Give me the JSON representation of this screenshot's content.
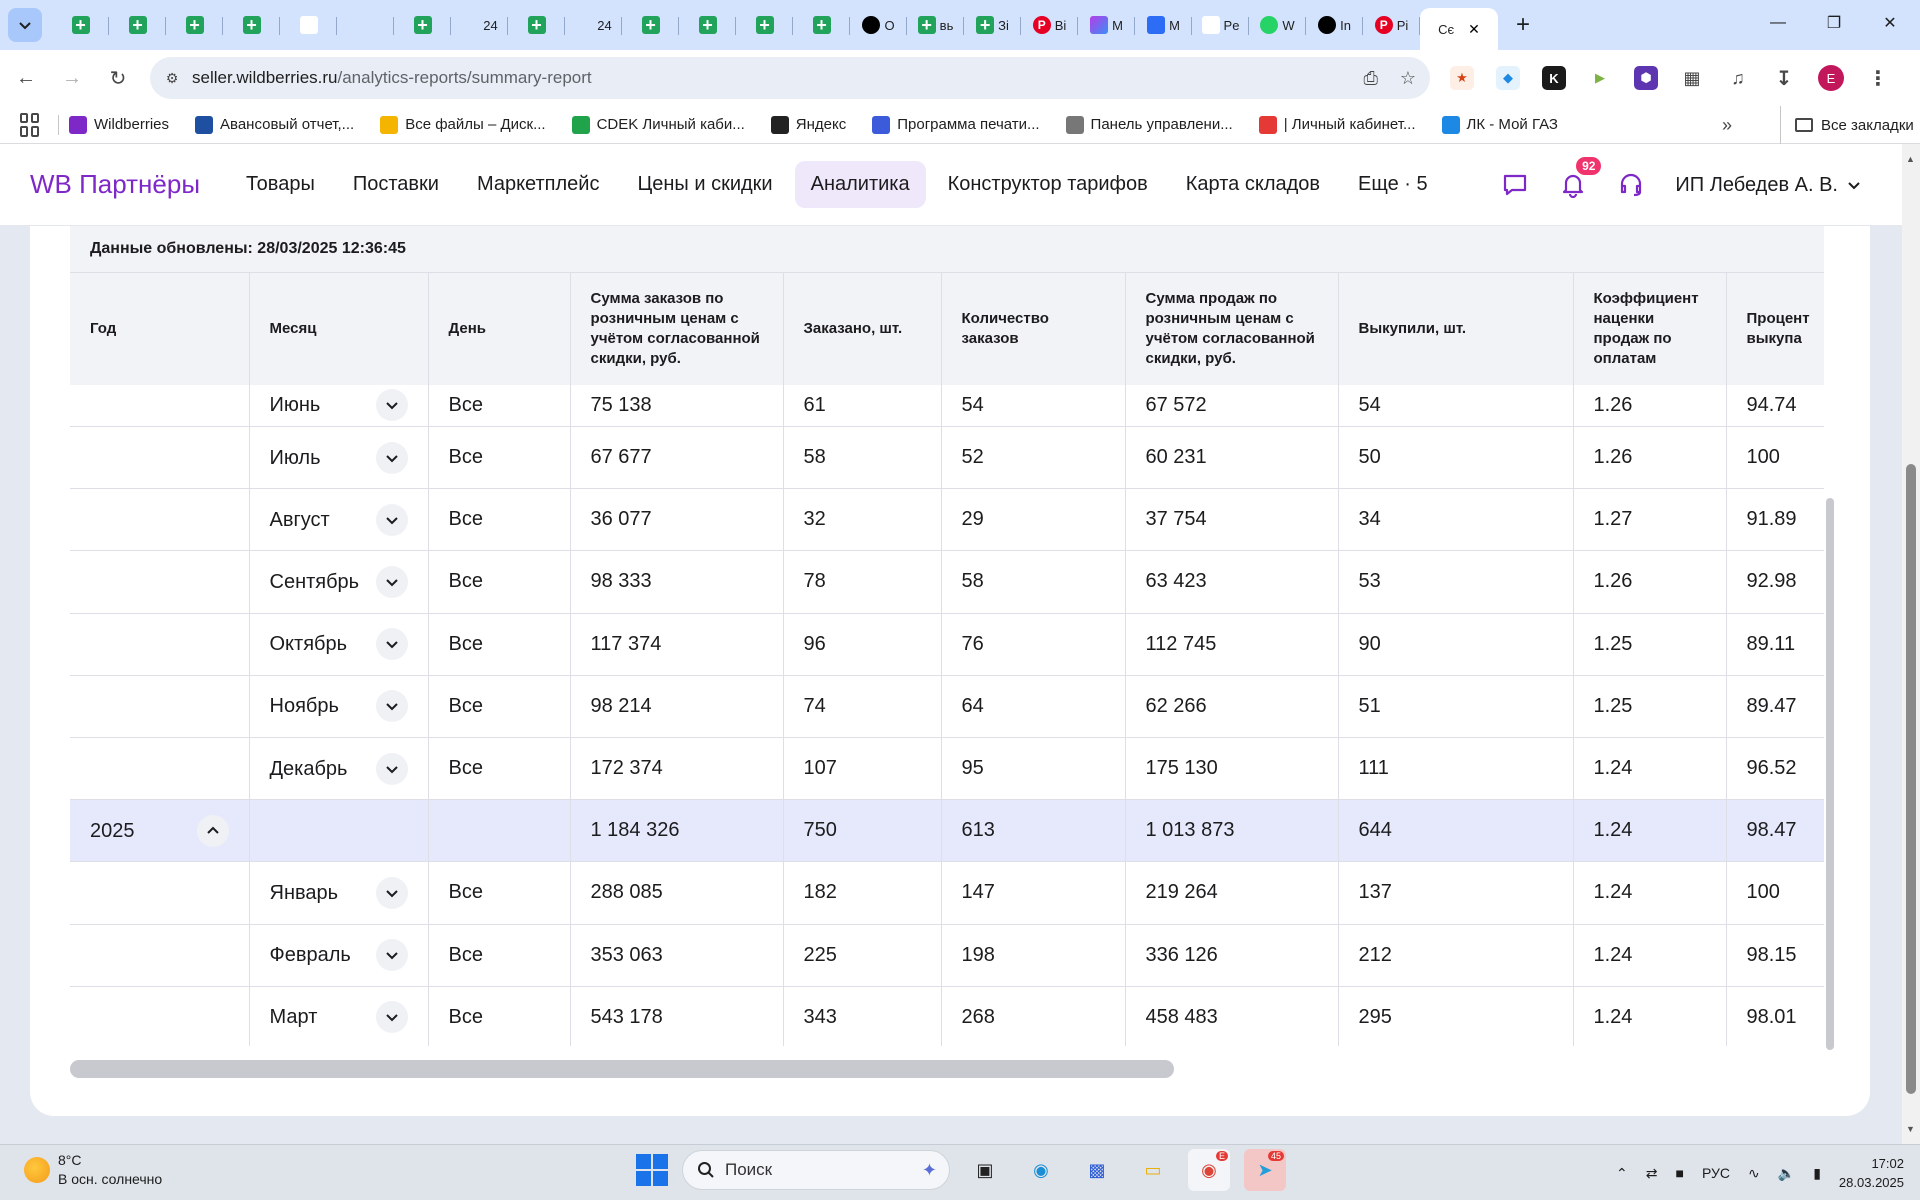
{
  "browser": {
    "tabs": [
      {
        "icon": "green",
        "label": ""
      },
      {
        "icon": "green",
        "label": ""
      },
      {
        "icon": "green",
        "label": ""
      },
      {
        "icon": "green",
        "label": ""
      },
      {
        "icon": "ya",
        "label": ""
      },
      {
        "icon": "blue",
        "label": ""
      },
      {
        "icon": "green",
        "label": ""
      },
      {
        "icon": "blue",
        "label": "24"
      },
      {
        "icon": "green",
        "label": ""
      },
      {
        "icon": "blue",
        "label": "24"
      },
      {
        "icon": "green",
        "label": ""
      },
      {
        "icon": "green",
        "label": ""
      },
      {
        "icon": "green",
        "label": ""
      },
      {
        "icon": "green",
        "label": ""
      },
      {
        "icon": "dark",
        "label": "O"
      },
      {
        "icon": "green",
        "label": "вь"
      },
      {
        "icon": "green",
        "label": "Зі"
      },
      {
        "icon": "pin",
        "label": "Ві"
      },
      {
        "icon": "purple",
        "label": "M"
      },
      {
        "icon": "msg",
        "label": "M"
      },
      {
        "icon": "ya",
        "label": "Pe"
      },
      {
        "icon": "wa",
        "label": "W"
      },
      {
        "icon": "dark",
        "label": "In"
      },
      {
        "icon": "pin",
        "label": "Pi"
      }
    ],
    "active_tab_label": "Сє",
    "url_host": "seller.wildberries.ru",
    "url_path": "/analytics-reports/summary-report",
    "profile_letter": "E",
    "bookmarks": [
      {
        "label": "Wildberries",
        "color": "#7e28c8"
      },
      {
        "label": "Авансовый отчет,...",
        "color": "#1e4fa0"
      },
      {
        "label": "Все файлы – Диск...",
        "color": "#f4b400"
      },
      {
        "label": "CDEK Личный каби...",
        "color": "#20a34a"
      },
      {
        "label": "Яндекс",
        "color": "#222222"
      },
      {
        "label": "Программа печати...",
        "color": "#3b5bdb"
      },
      {
        "label": "Панель управлени...",
        "color": "#777777"
      },
      {
        "label": "| Личный кабинет...",
        "color": "#e53935"
      },
      {
        "label": "ЛК - Мой ГАЗ",
        "color": "#1e88e5"
      }
    ],
    "all_bookmarks": "Все закладки"
  },
  "site": {
    "logo": "WB Партнёры",
    "nav": [
      "Товары",
      "Поставки",
      "Маркетплейс",
      "Цены и скидки",
      "Аналитика",
      "Конструктор тарифов",
      "Карта складов",
      "Еще · 5"
    ],
    "active_nav": 4,
    "notifications": "92",
    "user": "ИП Лебедев А. В."
  },
  "report": {
    "updated": "Данные обновлены: 28/03/2025 12:36:45",
    "columns": [
      "Год",
      "Месяц",
      "День",
      "Сумма заказов по розничным ценам с учётом согласованной скидки, руб.",
      "Заказано, шт.",
      "Количество заказов",
      "Сумма продаж по розничным ценам с учётом согласованной скидки, руб.",
      "Выкупили, шт.",
      "Коэффициент наценки продаж по оплатам",
      "Процент выкупа"
    ],
    "rows": [
      {
        "type": "month",
        "year": "",
        "month": "Июнь",
        "day": "Все",
        "v": [
          "75 138",
          "61",
          "54",
          "67 572",
          "54",
          "1.26",
          "94.74"
        ]
      },
      {
        "type": "month",
        "year": "",
        "month": "Июль",
        "day": "Все",
        "v": [
          "67 677",
          "58",
          "52",
          "60 231",
          "50",
          "1.26",
          "100"
        ]
      },
      {
        "type": "month",
        "year": "",
        "month": "Август",
        "day": "Все",
        "v": [
          "36 077",
          "32",
          "29",
          "37 754",
          "34",
          "1.27",
          "91.89"
        ]
      },
      {
        "type": "month",
        "year": "",
        "month": "Сентябрь",
        "day": "Все",
        "v": [
          "98 333",
          "78",
          "58",
          "63 423",
          "53",
          "1.26",
          "92.98"
        ]
      },
      {
        "type": "month",
        "year": "",
        "month": "Октябрь",
        "day": "Все",
        "v": [
          "117 374",
          "96",
          "76",
          "112 745",
          "90",
          "1.25",
          "89.11"
        ]
      },
      {
        "type": "month",
        "year": "",
        "month": "Ноябрь",
        "day": "Все",
        "v": [
          "98 214",
          "74",
          "64",
          "62 266",
          "51",
          "1.25",
          "89.47"
        ]
      },
      {
        "type": "month",
        "year": "",
        "month": "Декабрь",
        "day": "Все",
        "v": [
          "172 374",
          "107",
          "95",
          "175 130",
          "111",
          "1.24",
          "96.52"
        ]
      },
      {
        "type": "year",
        "year": "2025",
        "month": "",
        "day": "",
        "v": [
          "1 184 326",
          "750",
          "613",
          "1 013 873",
          "644",
          "1.24",
          "98.47"
        ]
      },
      {
        "type": "month",
        "year": "",
        "month": "Январь",
        "day": "Все",
        "v": [
          "288 085",
          "182",
          "147",
          "219 264",
          "137",
          "1.24",
          "100"
        ]
      },
      {
        "type": "month",
        "year": "",
        "month": "Февраль",
        "day": "Все",
        "v": [
          "353 063",
          "225",
          "198",
          "336 126",
          "212",
          "1.24",
          "98.15"
        ]
      },
      {
        "type": "month",
        "year": "",
        "month": "Март",
        "day": "Все",
        "v": [
          "543 178",
          "343",
          "268",
          "458 483",
          "295",
          "1.24",
          "98.01"
        ]
      }
    ]
  },
  "taskbar": {
    "temp": "8°C",
    "weather": "В осн. солнечно",
    "search_placeholder": "Поиск",
    "telegram_badge": "45",
    "chrome_badge": "E",
    "lang": "РУС",
    "time": "17:02",
    "date": "28.03.2025"
  }
}
